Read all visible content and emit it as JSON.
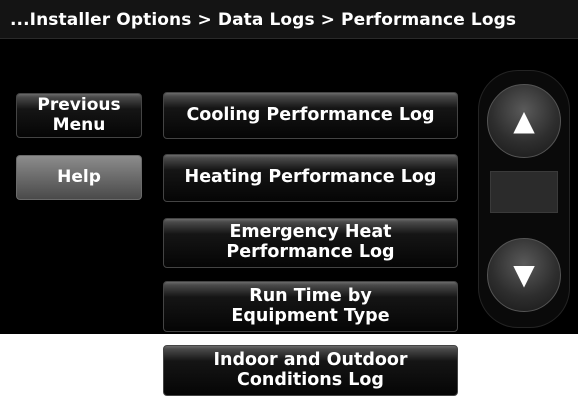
{
  "breadcrumb": "...Installer Options > Data Logs > Performance Logs",
  "left_buttons": {
    "previous_menu": "Previous\nMenu",
    "help": "Help"
  },
  "menu_items": [
    "Cooling Performance Log",
    "Heating Performance Log",
    "Emergency Heat\nPerformance Log",
    "Run Time by\nEquipment Type",
    "Indoor and Outdoor\nConditions Log"
  ],
  "scroll": {
    "up_icon": "▲",
    "down_icon": "▼"
  }
}
